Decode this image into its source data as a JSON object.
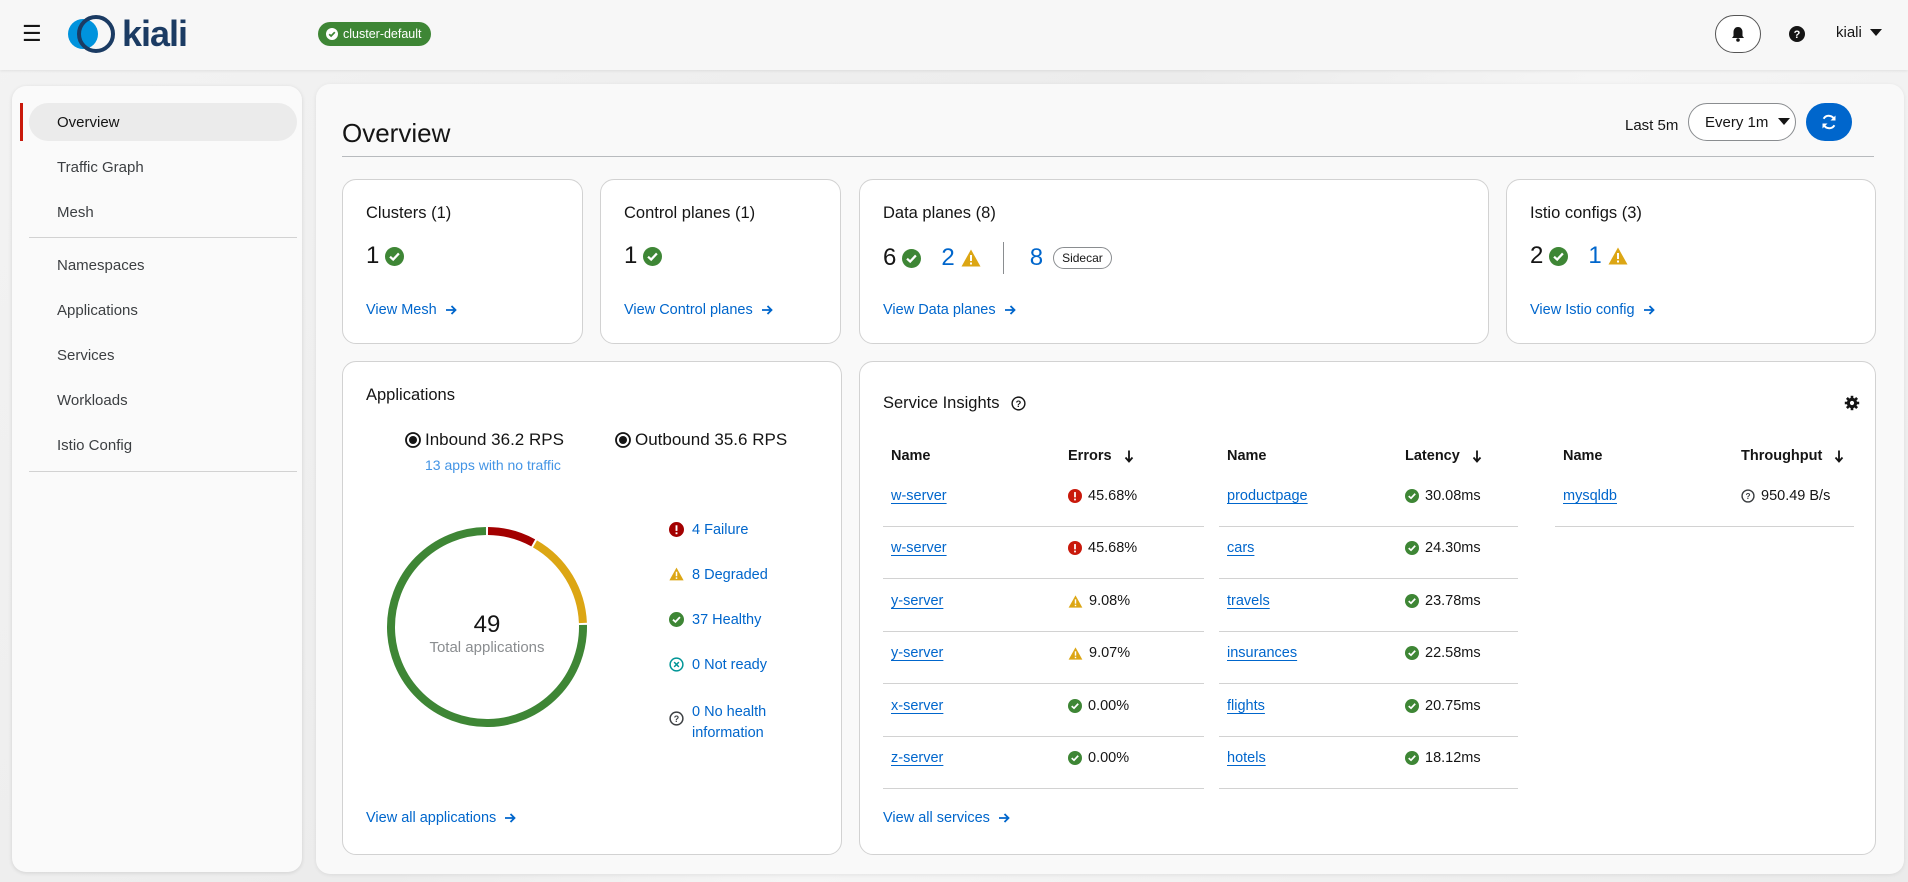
{
  "masthead": {
    "logo_text": "kiali",
    "cluster_badge": "cluster-default",
    "user": "kiali"
  },
  "sidebar": {
    "items": [
      {
        "label": "Overview",
        "active": true
      },
      {
        "label": "Traffic Graph"
      },
      {
        "label": "Mesh"
      },
      {
        "label": "Namespaces"
      },
      {
        "label": "Applications"
      },
      {
        "label": "Services"
      },
      {
        "label": "Workloads"
      },
      {
        "label": "Istio Config"
      }
    ]
  },
  "page": {
    "title": "Overview",
    "time_range": "Last 5m",
    "refresh_interval": "Every 1m"
  },
  "cards": {
    "clusters": {
      "title": "Clusters (1)",
      "count": "1",
      "link": "View Mesh"
    },
    "control_planes": {
      "title": "Control planes (1)",
      "count": "1",
      "link": "View Control planes"
    },
    "data_planes": {
      "title": "Data planes (8)",
      "healthy": "6",
      "warning": "2",
      "sidecar_count": "8",
      "sidecar_label": "Sidecar",
      "link": "View Data planes"
    },
    "istio_configs": {
      "title": "Istio configs (3)",
      "healthy": "2",
      "warning": "1",
      "link": "View Istio config"
    }
  },
  "applications": {
    "title": "Applications",
    "inbound": "Inbound 36.2 RPS",
    "outbound": "Outbound 35.6 RPS",
    "no_traffic": "13 apps with no traffic",
    "total": "49",
    "total_label": "Total applications",
    "statuses": [
      {
        "label": "4 Failure",
        "value": 4,
        "color": "#a30000",
        "icon": "exclamation-circle-icon"
      },
      {
        "label": "8 Degraded",
        "value": 8,
        "color": "#dca614",
        "icon": "warning-triangle-icon"
      },
      {
        "label": "37 Healthy",
        "value": 37,
        "color": "#3e8635",
        "icon": "check-circle-icon"
      },
      {
        "label": "0 Not ready",
        "value": 0,
        "color": "#009596",
        "icon": "minus-circle-icon"
      },
      {
        "label_line1": "0 No health",
        "label_line2": "information",
        "value": 0,
        "icon": "unknown-circle-icon"
      }
    ],
    "link": "View all applications"
  },
  "service_insights": {
    "title": "Service Insights",
    "errors": {
      "headers": [
        "Name",
        "Errors"
      ],
      "rows": [
        {
          "name": "w-server",
          "value": "45.68%",
          "status": "error"
        },
        {
          "name": "w-server",
          "value": "45.68%",
          "status": "error"
        },
        {
          "name": "y-server",
          "value": "9.08%",
          "status": "warning"
        },
        {
          "name": "y-server",
          "value": "9.07%",
          "status": "warning"
        },
        {
          "name": "x-server",
          "value": "0.00%",
          "status": "ok"
        },
        {
          "name": "z-server",
          "value": "0.00%",
          "status": "ok"
        }
      ]
    },
    "latency": {
      "headers": [
        "Name",
        "Latency"
      ],
      "rows": [
        {
          "name": "productpage",
          "value": "30.08ms",
          "status": "ok"
        },
        {
          "name": "cars",
          "value": "24.30ms",
          "status": "ok"
        },
        {
          "name": "travels",
          "value": "23.78ms",
          "status": "ok"
        },
        {
          "name": "insurances",
          "value": "22.58ms",
          "status": "ok"
        },
        {
          "name": "flights",
          "value": "20.75ms",
          "status": "ok"
        },
        {
          "name": "hotels",
          "value": "18.12ms",
          "status": "ok"
        }
      ]
    },
    "throughput": {
      "headers": [
        "Name",
        "Throughput"
      ],
      "rows": [
        {
          "name": "mysqldb",
          "value": "950.49 B/s",
          "status": "unknown"
        }
      ]
    },
    "link": "View all services"
  },
  "colors": {
    "success": "#3e8635",
    "warning": "#dca614",
    "danger": "#c9190b",
    "link": "#0066cc",
    "primary": "#0066cc"
  }
}
